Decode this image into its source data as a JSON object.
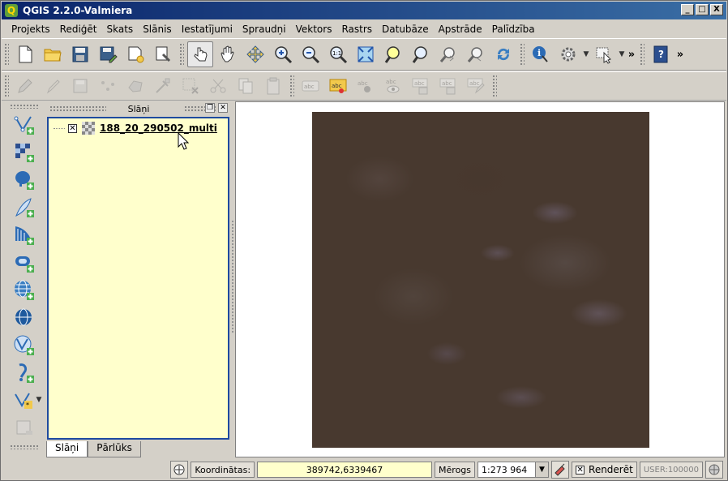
{
  "window": {
    "title": "QGIS 2.2.0-Valmiera",
    "buttons": [
      "_",
      "□",
      "X"
    ]
  },
  "menu": [
    "Projekts",
    "Rediģēt",
    "Skats",
    "Slānis",
    "Iestatījumi",
    "Spraudņi",
    "Vektors",
    "Rastrs",
    "Datubāze",
    "Apstrāde",
    "Palīdzība"
  ],
  "toolbar1": {
    "icons": [
      "new-project",
      "open-project",
      "save-project",
      "save-as",
      "new-print-composer",
      "composer-manager",
      "touch-tool",
      "pan",
      "pan-to-selection",
      "zoom-in",
      "zoom-out",
      "zoom-native",
      "zoom-full",
      "zoom-to-selection",
      "zoom-to-layer",
      "zoom-last",
      "zoom-next",
      "refresh",
      "identify",
      "action",
      "select",
      "overflow",
      "help"
    ],
    "overflow": "»"
  },
  "toolbar2": {
    "icons": [
      "toggle-editing",
      "pencil",
      "save-edits",
      "add-feature",
      "move-feature",
      "node-tool",
      "delete-selected",
      "cut",
      "copy",
      "paste",
      "label-abc",
      "label-tool",
      "pin-labels",
      "show-hide-labels",
      "move-label",
      "rotate-label",
      "change-label"
    ],
    "label_text": "abc"
  },
  "vtoolbar": [
    "add-vector-layer",
    "add-raster-layer",
    "add-postgis-layer",
    "add-spatialite-layer",
    "add-mssql-layer",
    "add-oracle-layer",
    "add-wms-layer",
    "add-wcs-layer",
    "add-wfs-layer",
    "add-delimited-text-layer",
    "new-shapefile-layer",
    "remove-layer"
  ],
  "layers_panel": {
    "title": "Slāņi",
    "layers": [
      {
        "name": "188_20_290502_multi",
        "visible": true
      }
    ],
    "tabs": [
      "Slāņi",
      "Pārlūks"
    ]
  },
  "statusbar": {
    "coord_label": "Koordinātas:",
    "coord_value": "389742,6339467",
    "scale_label": "Mērogs",
    "scale_value": "1:273 964",
    "render_label": "Renderēt",
    "crs": "USER:100000"
  },
  "colors": {
    "titlebar": "#0a246a",
    "raster_base": "#48392f",
    "layers_bg": "#ffffcc",
    "selection_border": "#1e4aa0"
  }
}
